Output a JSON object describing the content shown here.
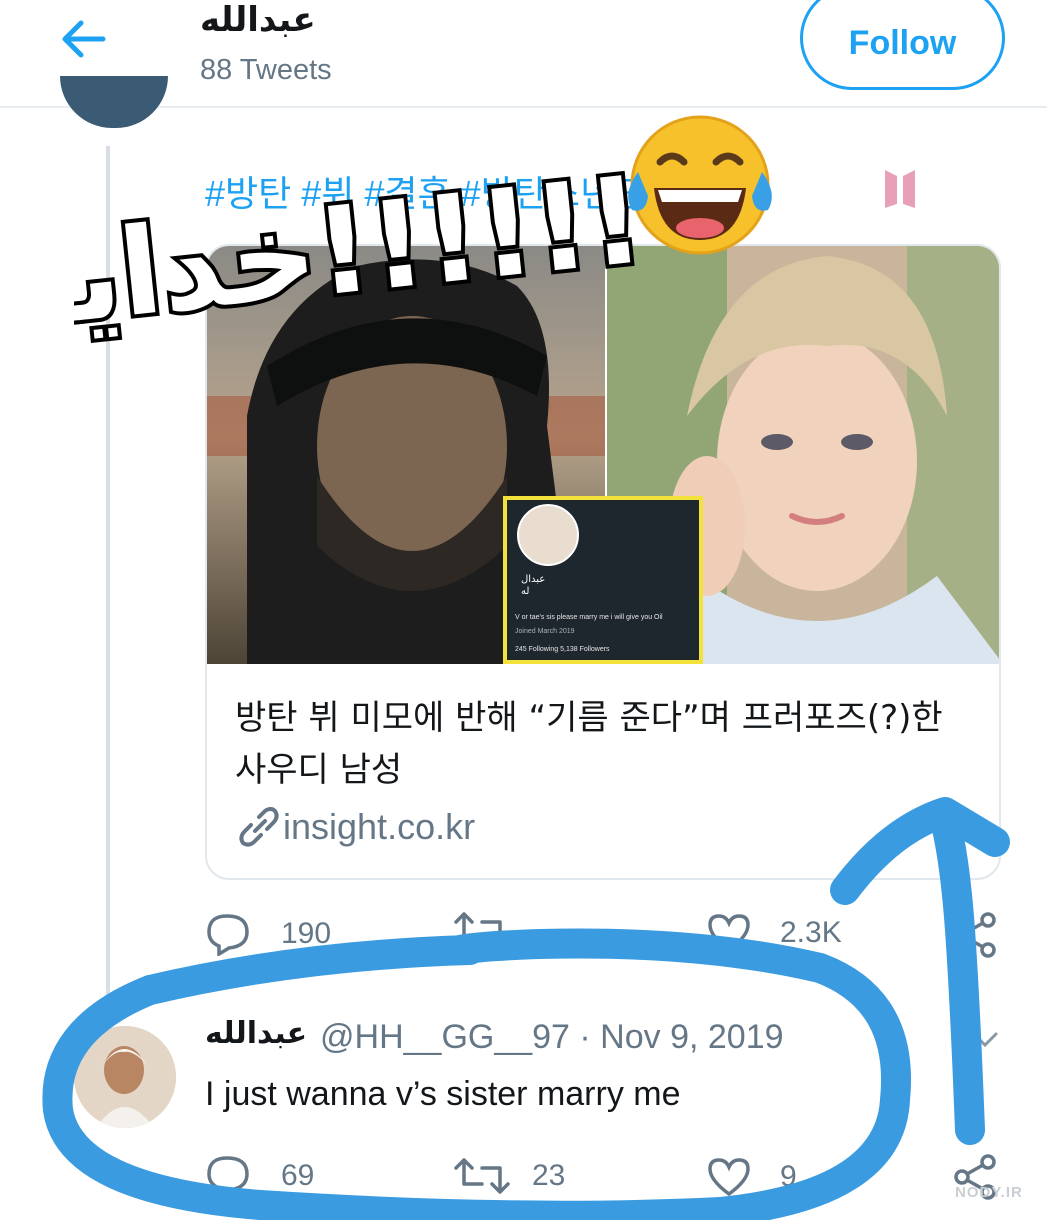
{
  "header": {
    "title": "عبدالله",
    "tweets_count": "88 Tweets",
    "follow_label": "Follow"
  },
  "tweet": {
    "hashtags": "#방탄 #뷔 #결혼 #방탄소년단 #BTS",
    "overlay_text": "خدایا!!!!!!!",
    "card": {
      "title": "방탄 뷔 미모에 반해 “기름 준다”며 프러포즈(?)한 사우디 남성",
      "domain": "insight.co.kr",
      "inset_name": "عبدال\nله",
      "inset_bio": "V or tae's sis please marry me i will give you Oil",
      "inset_joined": "Joined March 2019",
      "inset_stats": "245 Following   5,138 Followers"
    },
    "actions": {
      "replies": "190",
      "likes": "2.3K"
    }
  },
  "reply": {
    "name": "عبدالله",
    "meta": "@HH__GG__97 · Nov 9, 2019",
    "text": "I just wanna v’s sister marry me",
    "actions": {
      "replies": "69",
      "retweets": "23",
      "likes": "9"
    }
  },
  "watermark": "NODY.IR",
  "colors": {
    "accent": "#1da1f2",
    "secondary_text": "#657786",
    "annotation": "#3a9be0"
  }
}
